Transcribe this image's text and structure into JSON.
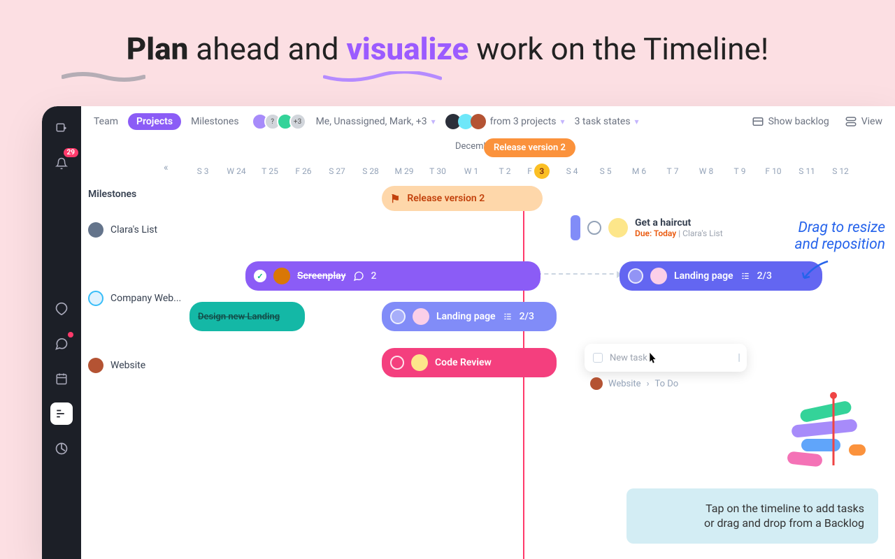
{
  "hero": {
    "w1": "Plan",
    "w2": " ahead and ",
    "w3": "visualize",
    "w4": " work on the Timeline!"
  },
  "rail": {
    "badge": "29"
  },
  "top": {
    "team": "Team",
    "projects": "Projects",
    "milestones": "Milestones",
    "plus_avatars": "+3",
    "people": "Me, Unassigned, Mark, +3",
    "projects_filter": "from 3 projects",
    "states": "3 task states",
    "backlog": "Show backlog",
    "view": "View"
  },
  "month": "December",
  "version_badge": "Release version 2",
  "dates": [
    {
      "w": "S",
      "d": "3"
    },
    {
      "w": "W",
      "d": "24"
    },
    {
      "w": "T",
      "d": "25"
    },
    {
      "w": "F",
      "d": "26"
    },
    {
      "w": "S",
      "d": "27"
    },
    {
      "w": "S",
      "d": "28"
    },
    {
      "w": "M",
      "d": "29"
    },
    {
      "w": "T",
      "d": "30"
    },
    {
      "w": "W",
      "d": "1"
    },
    {
      "w": "T",
      "d": "2"
    },
    {
      "w": "F",
      "d": "3",
      "hl": true
    },
    {
      "w": "S",
      "d": "4"
    },
    {
      "w": "S",
      "d": "5"
    },
    {
      "w": "M",
      "d": "6"
    },
    {
      "w": "T",
      "d": "7"
    },
    {
      "w": "W",
      "d": "8"
    },
    {
      "w": "T",
      "d": "9"
    },
    {
      "w": "F",
      "d": "10"
    },
    {
      "w": "S",
      "d": "11"
    },
    {
      "w": "S",
      "d": "12"
    }
  ],
  "rows": {
    "milestones": "Milestones",
    "r1": "Clara's List",
    "r2": "Company Web...",
    "r3": "Website"
  },
  "milestone_bar": "Release version 2",
  "haircut": {
    "title": "Get a haircut",
    "due": "Due: Today",
    "list": " | Clara's List"
  },
  "screenplay": {
    "title": "Screenplay",
    "comments": "2"
  },
  "landing1": {
    "title": "Landing page",
    "sub": "2/3"
  },
  "design": "Design new Landing",
  "landing2": {
    "title": "Landing page",
    "sub": "2/3"
  },
  "review": "Code Review",
  "newtask": {
    "placeholder": "New task",
    "crumb_proj": "Website",
    "crumb_state": "To Do"
  },
  "anno1": {
    "l1": "Drag to resize",
    "l2": "and reposition"
  },
  "tip": {
    "l1": "Tap on the timeline to add tasks",
    "l2": "or drag and drop from a Backlog"
  }
}
